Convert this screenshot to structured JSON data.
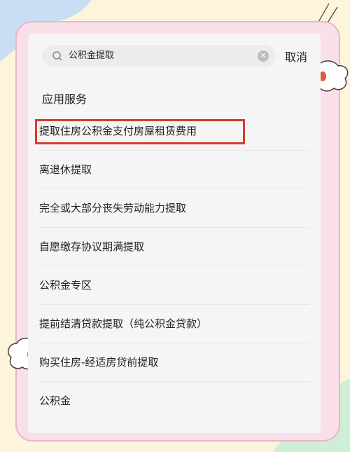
{
  "search": {
    "query": "公积金提取",
    "cancel_label": "取消"
  },
  "section": {
    "title": "应用服务"
  },
  "results": [
    {
      "label": "提取住房公积金支付房屋租赁费用"
    },
    {
      "label": "离退休提取"
    },
    {
      "label": "完全或大部分丧失劳动能力提取"
    },
    {
      "label": "自愿缴存协议期满提取"
    },
    {
      "label": "公积金专区"
    },
    {
      "label": "提前结清贷款提取（纯公积金贷款）"
    },
    {
      "label": "购买住房-经适房贷前提取"
    },
    {
      "label": "公积金"
    }
  ],
  "colors": {
    "highlight": "#d93a2b",
    "background": "#fdf4dc",
    "frame": "#f9dfe8"
  }
}
